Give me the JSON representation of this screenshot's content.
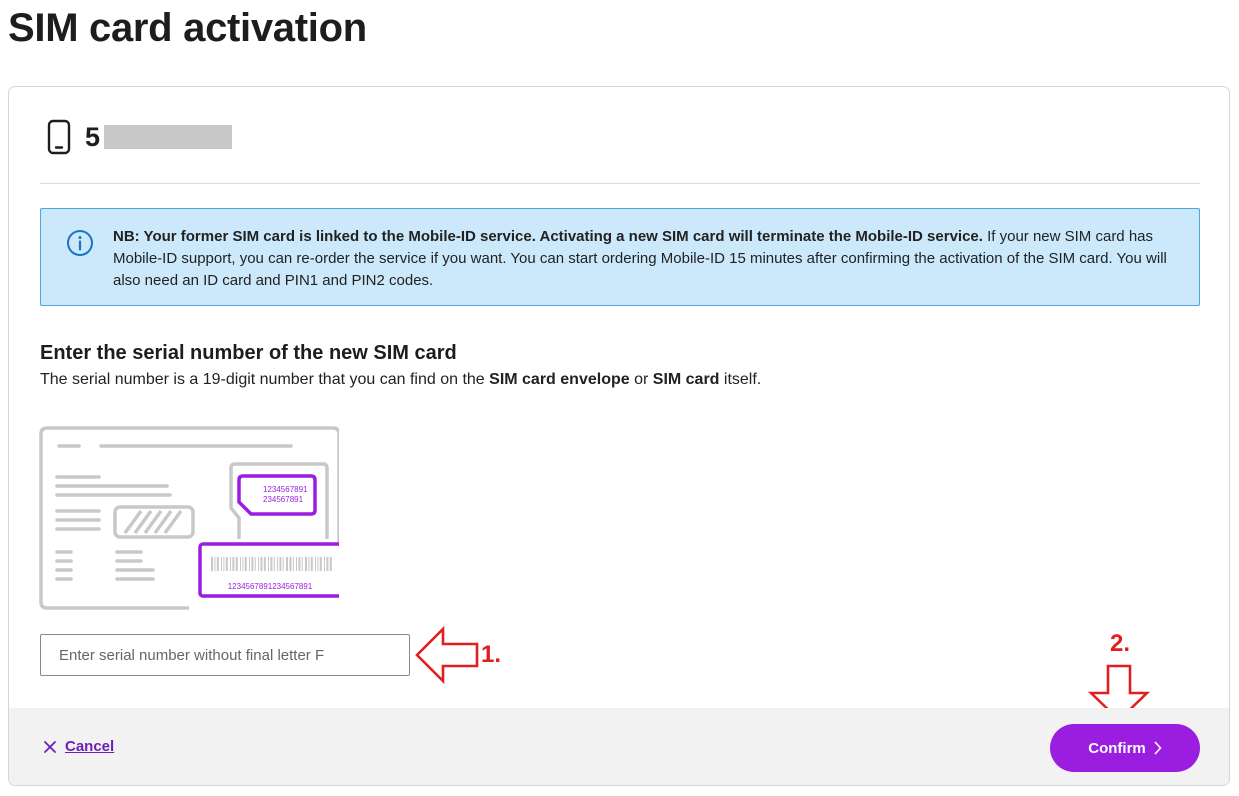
{
  "page": {
    "title": "SIM card activation"
  },
  "phone": {
    "number_visible": "5"
  },
  "notice": {
    "bold_text": "NB: Your former SIM card is linked to the Mobile-ID service. Activating a new SIM card will terminate the Mobile-ID service.",
    "text": " If your new SIM card has Mobile-ID support, you can re-order the service if you want. You can start ordering Mobile-ID 15 minutes after confirming the activation of the SIM card. You will also need an ID card and PIN1 and PIN2 codes."
  },
  "serial_section": {
    "title": "Enter the serial number of the new SIM card",
    "desc_part1": "The serial number is a 19-digit number that you can find on the ",
    "desc_bold1": "SIM card envelope",
    "desc_part2": " or ",
    "desc_bold2": "SIM card",
    "desc_part3": " itself."
  },
  "illustration": {
    "sim_line1": "1234567891",
    "sim_line2": "234567891",
    "barcode_number": "1234567891234567891"
  },
  "input": {
    "placeholder": "Enter serial number without final letter F",
    "value": ""
  },
  "annotations": {
    "step1": "1.",
    "step2": "2.",
    "color": "#e02020"
  },
  "footer": {
    "cancel_label": "Cancel",
    "confirm_label": "Confirm"
  },
  "colors": {
    "accent": "#9b1de0",
    "link": "#6f1fb5",
    "notice_bg": "#cce9fb",
    "notice_border": "#4aa8e0"
  }
}
